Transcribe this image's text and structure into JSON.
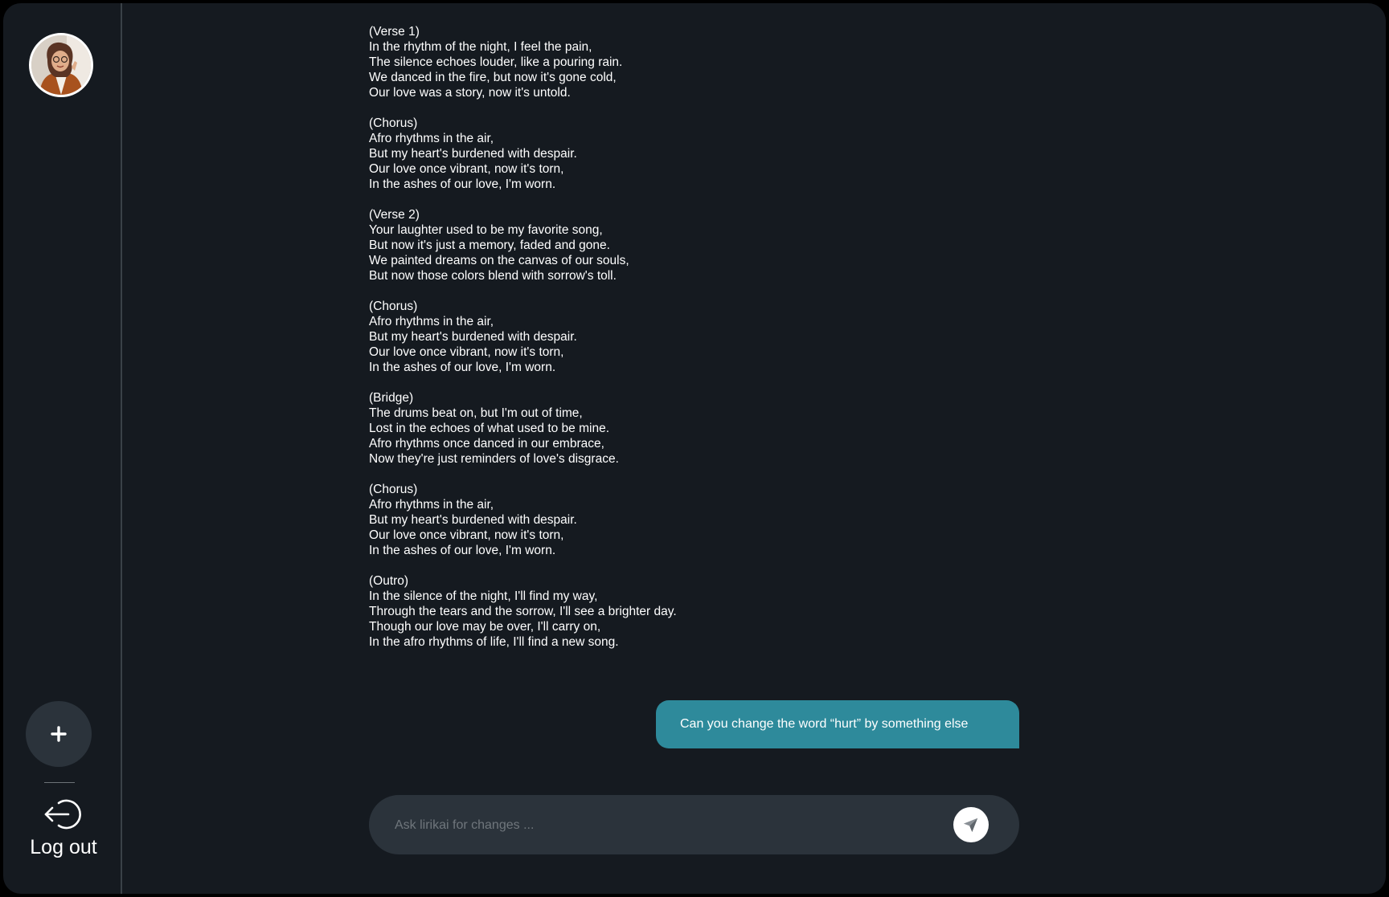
{
  "sidebar": {
    "new_icon": "plus-icon",
    "logout_icon": "logout-icon",
    "logout_label": "Log out"
  },
  "lyrics": [
    {
      "heading": "(Verse 1)",
      "lines": [
        "In the rhythm of the night, I feel the pain,",
        "The silence echoes louder, like a pouring rain.",
        "We danced in the fire, but now it's gone cold,",
        "Our love was a story, now it's untold."
      ]
    },
    {
      "heading": "(Chorus)",
      "lines": [
        "Afro rhythms in the air,",
        "But my heart's burdened with despair.",
        "Our love once vibrant, now it's torn,",
        "In the ashes of our love, I'm worn."
      ]
    },
    {
      "heading": "(Verse 2)",
      "lines": [
        "Your laughter used to be my favorite song,",
        "But now it's just a memory, faded and gone.",
        "We painted dreams on the canvas of our souls,",
        "But now those colors blend with sorrow's toll."
      ]
    },
    {
      "heading": "(Chorus)",
      "lines": [
        "Afro rhythms in the air,",
        "But my heart's burdened with despair.",
        "Our love once vibrant, now it's torn,",
        "In the ashes of our love, I'm worn."
      ]
    },
    {
      "heading": "(Bridge)",
      "lines": [
        "The drums beat on, but I'm out of time,",
        "Lost in the echoes of what used to be mine.",
        "Afro rhythms once danced in our embrace,",
        "Now they're just reminders of love's disgrace."
      ]
    },
    {
      "heading": "(Chorus)",
      "lines": [
        "Afro rhythms in the air,",
        "But my heart's burdened with despair.",
        "Our love once vibrant, now it's torn,",
        "In the ashes of our love, I'm worn."
      ]
    },
    {
      "heading": "(Outro)",
      "lines": [
        "In the silence of the night, I'll find my way,",
        "Through the tears and the sorrow, I'll see a brighter day.",
        "Though our love may be over, I'll carry on,",
        "In the afro rhythms of life, I'll find a new song."
      ]
    }
  ],
  "chat": {
    "user_message": "Can you change the word “hurt” by something else"
  },
  "composer": {
    "placeholder": "Ask lirikai for changes ...",
    "value": "",
    "send_icon": "send-icon"
  },
  "colors": {
    "background": "#151a20",
    "surface": "#2b333b",
    "accent": "#2e8a9b",
    "text": "#ffffff"
  }
}
